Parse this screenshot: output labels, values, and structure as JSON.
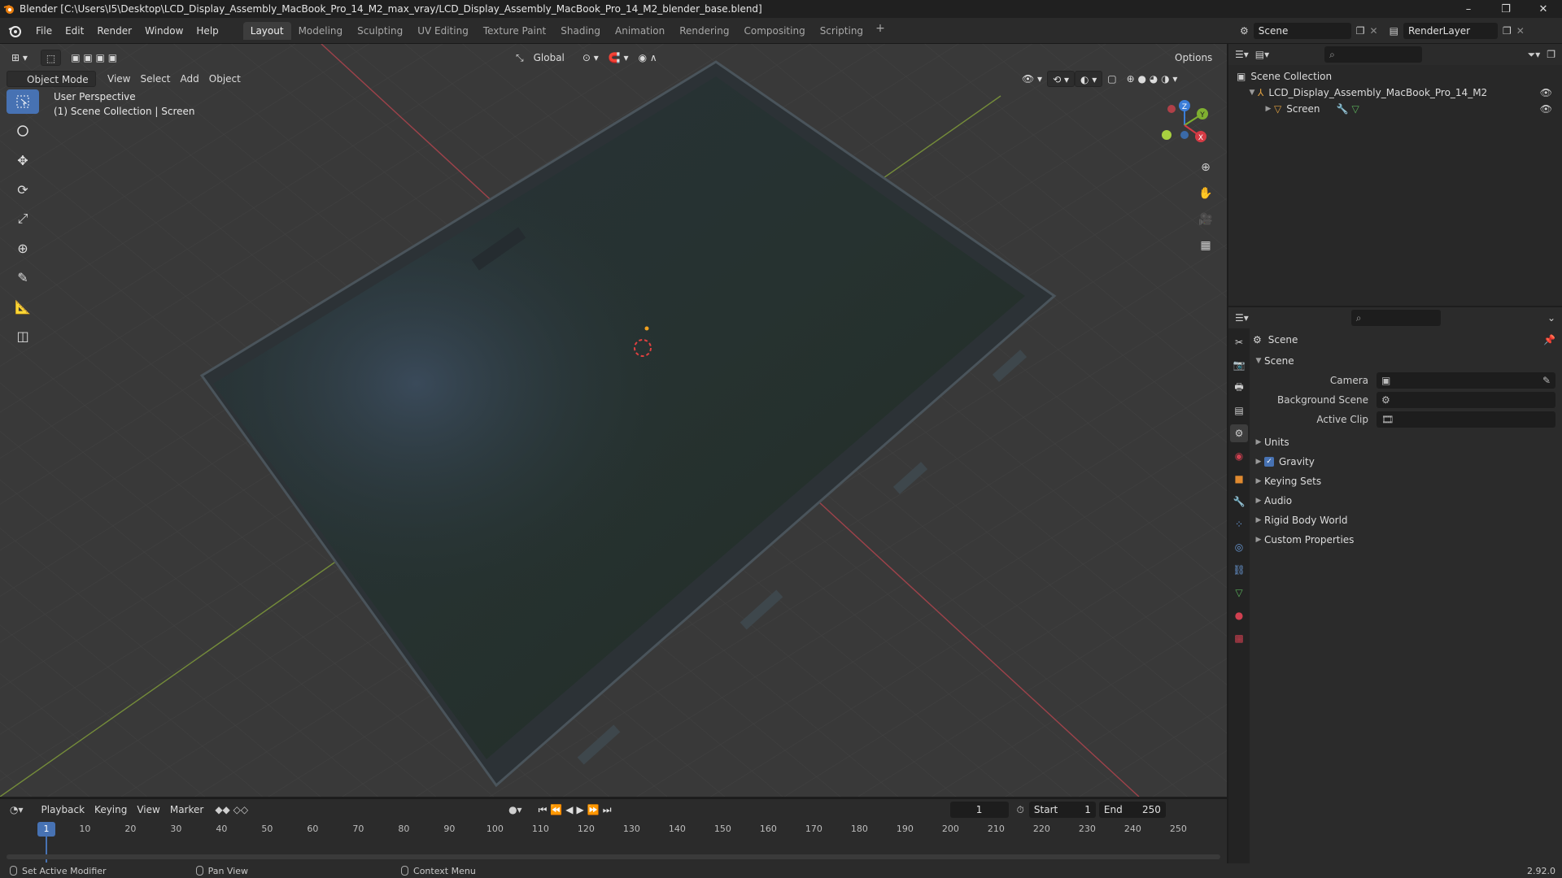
{
  "window": {
    "title": "Blender [C:\\Users\\I5\\Desktop\\LCD_Display_Assembly_MacBook_Pro_14_M2_max_vray/LCD_Display_Assembly_MacBook_Pro_14_M2_blender_base.blend]",
    "controls": [
      "–",
      "❐",
      "✕"
    ]
  },
  "menu": {
    "items": [
      "File",
      "Edit",
      "Render",
      "Window",
      "Help"
    ],
    "workspaces": [
      "Layout",
      "Modeling",
      "Sculpting",
      "UV Editing",
      "Texture Paint",
      "Shading",
      "Animation",
      "Rendering",
      "Compositing",
      "Scripting"
    ],
    "active_workspace": "Layout",
    "add": "+",
    "scene": "Scene",
    "view_layer": "RenderLayer"
  },
  "viewport": {
    "mode": "Object Mode",
    "menus": [
      "View",
      "Select",
      "Add",
      "Object"
    ],
    "transform_orientation": "Global",
    "options": "Options",
    "info_line1": "User Perspective",
    "info_line2": "(1) Scene Collection | Screen",
    "gizmo_axes": [
      "X",
      "Y",
      "Z"
    ]
  },
  "outliner": {
    "root": "Scene Collection",
    "items": [
      {
        "label": "LCD_Display_Assembly_MacBook_Pro_14_M2"
      },
      {
        "label": "Screen"
      }
    ]
  },
  "properties": {
    "context": "Scene",
    "panel_title": "Scene",
    "fields": [
      {
        "label": "Camera",
        "value": ""
      },
      {
        "label": "Background Scene",
        "value": ""
      },
      {
        "label": "Active Clip",
        "value": ""
      }
    ],
    "panels": [
      "Units",
      "Gravity",
      "Keying Sets",
      "Audio",
      "Rigid Body World",
      "Custom Properties"
    ],
    "gravity_checked": true
  },
  "timeline": {
    "menus": [
      "Playback",
      "Keying",
      "View",
      "Marker"
    ],
    "current_frame": "1",
    "start_label": "Start",
    "start": "1",
    "end_label": "End",
    "end": "250",
    "ticks": [
      "10",
      "20",
      "30",
      "40",
      "50",
      "60",
      "70",
      "80",
      "90",
      "100",
      "110",
      "120",
      "130",
      "140",
      "150",
      "160",
      "170",
      "180",
      "190",
      "200",
      "210",
      "220",
      "230",
      "240",
      "250"
    ],
    "cursor_label": "1"
  },
  "status": {
    "left": "Set Active Modifier",
    "middle": "Pan View",
    "right": "Context Menu",
    "version": "2.92.0"
  }
}
